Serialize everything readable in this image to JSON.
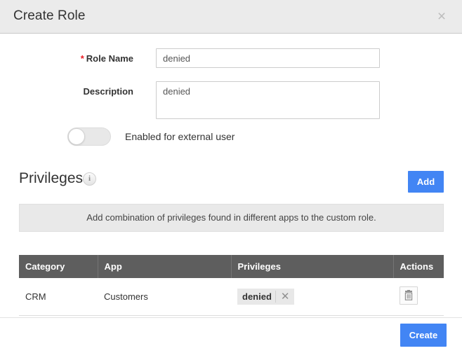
{
  "dialog": {
    "title": "Create Role",
    "close_label": "×"
  },
  "form": {
    "role_name": {
      "label": "Role Name",
      "required_marker": "*",
      "value": "denied",
      "placeholder": "Role Name"
    },
    "description": {
      "label": "Description",
      "value": "denied",
      "placeholder": "Description"
    },
    "external_user_toggle": {
      "label": "Enabled for external user",
      "state": "off"
    }
  },
  "privileges": {
    "heading": "Privileges",
    "info_icon_glyph": "i",
    "add_button_label": "Add",
    "banner_text": "Add combination of privileges found in different apps to the custom role.",
    "table": {
      "columns": [
        "Category",
        "App",
        "Privileges",
        "Actions"
      ],
      "rows": [
        {
          "category": "CRM",
          "app": "Customers",
          "privilege_tag": "denied",
          "tag_remove_label": "✕",
          "action_icon": "trash-icon"
        }
      ]
    }
  },
  "footer": {
    "create_label": "Create"
  },
  "colors": {
    "accent_blue": "#4285f4",
    "header_bg": "#ebebeb",
    "table_header_bg": "#5e5e5e",
    "banner_bg": "#e9e9e9",
    "required_red": "#ec1c24"
  }
}
